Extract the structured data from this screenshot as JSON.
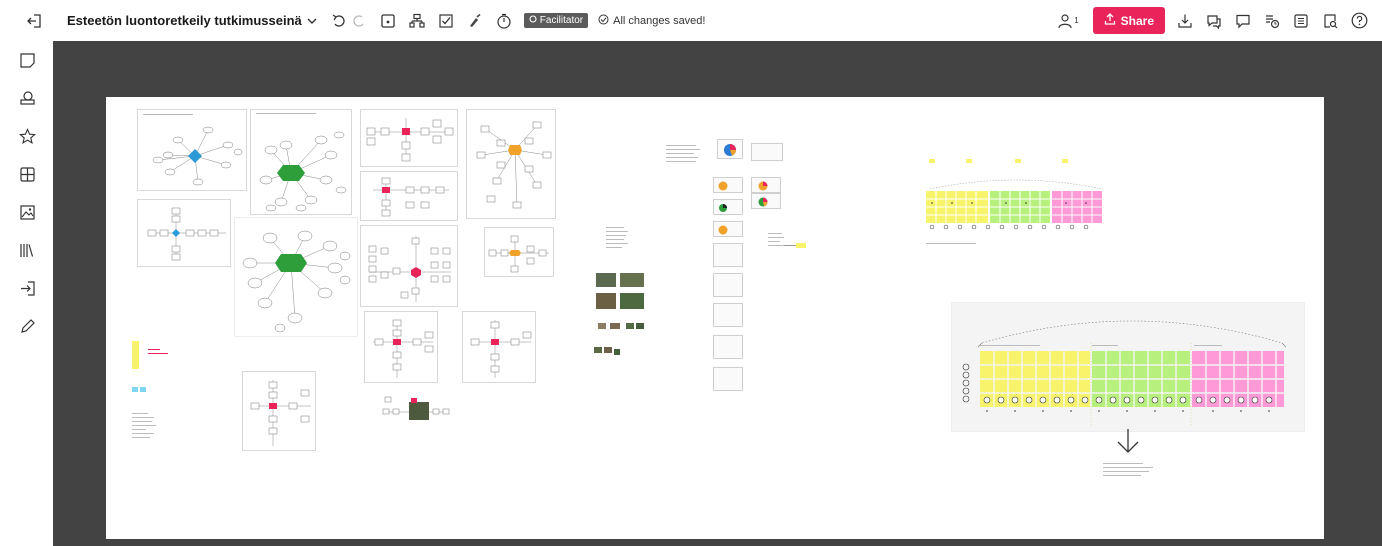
{
  "topbar": {
    "board_title": "Esteetön luontoretkeily tutkimusseinä",
    "facilitator_label": "Facilitator",
    "save_status": "All changes saved!",
    "share_label": "Share",
    "user_count": "1"
  },
  "icons": {
    "top_left": [
      "collapse-panel-icon",
      "chevron-down-icon",
      "undo-icon",
      "redo-icon",
      "sticky-tool-icon",
      "flow-icon",
      "checklist-icon",
      "brush-icon",
      "timer-icon"
    ],
    "top_right": [
      "people-icon",
      "upload-icon",
      "download-icon",
      "comments-icon",
      "chat-icon",
      "activity-icon",
      "board-list-icon",
      "search-board-icon",
      "help-icon"
    ],
    "left_toolbar": [
      "sticky-note-icon",
      "shapes-icon",
      "star-icon",
      "table-icon",
      "image-icon",
      "library-icon",
      "import-icon",
      "pen-icon"
    ]
  },
  "colors": {
    "accent": "#e8245a",
    "canvas_bg": "#434343",
    "board_bg": "#ffffff",
    "green_node": "#2e9e3a",
    "blue_node": "#2b9ad6",
    "pink_node": "#e8245a",
    "orange_node": "#f0a22a",
    "sticky_yellow": "#f7f36a",
    "sticky_green": "#b7f07c",
    "sticky_pink": "#ff9ad6"
  }
}
